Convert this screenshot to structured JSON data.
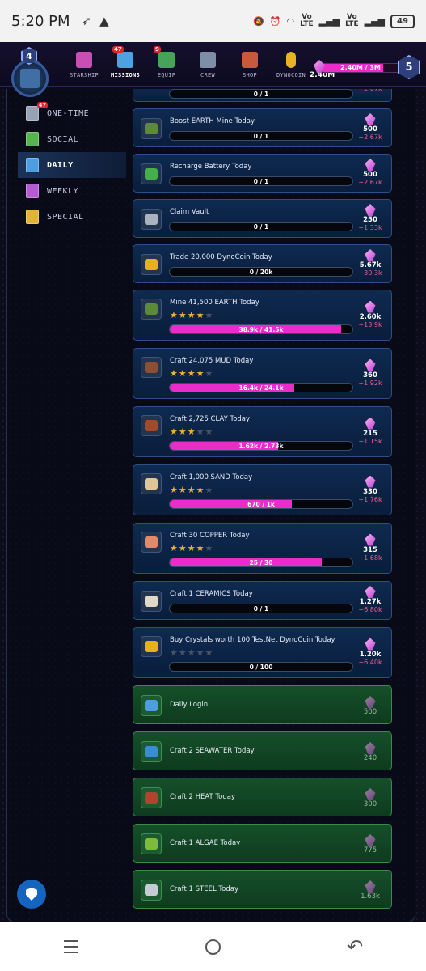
{
  "status_bar": {
    "time": "5:20 PM",
    "battery": "49",
    "vo_lte": "Vo\nLTE"
  },
  "header": {
    "player_level": "4",
    "rank": "5",
    "dynocoin_value": "2.40M",
    "crystals": {
      "label": "2.40M / 3M",
      "fill": 0.8
    },
    "nav": [
      {
        "label": "STARSHIP",
        "color": "#c94fb5"
      },
      {
        "label": "MISSIONS",
        "badge": "47",
        "color": "#4da3e0"
      },
      {
        "label": "EQUIP",
        "badge": "9",
        "color": "#46a35a"
      },
      {
        "label": "CREW",
        "color": "#7e8ea6"
      },
      {
        "label": "SHOP",
        "color": "#c8593c"
      },
      {
        "label": "DYNOCOIN",
        "color": "#e8b220"
      }
    ]
  },
  "sidebar": {
    "items": [
      {
        "label": "ONE-TIME",
        "badge": "47",
        "color": "#98a2b5"
      },
      {
        "label": "SOCIAL",
        "color": "#55b450"
      },
      {
        "label": "DAILY",
        "color": "#4d9de0"
      },
      {
        "label": "WEEKLY",
        "color": "#b65bd1"
      },
      {
        "label": "SPECIAL",
        "color": "#e3b338"
      }
    ]
  },
  "missions": [
    {
      "title": "",
      "progress": "0 / 1",
      "fill": 0,
      "reward": "",
      "xp": "+2.67k",
      "color": "#5a6a85",
      "partial": true
    },
    {
      "title": "Boost EARTH Mine Today",
      "progress": "0 / 1",
      "fill": 0,
      "reward": "500",
      "xp": "+2.67k",
      "color": "#5d8a3a"
    },
    {
      "title": "Recharge Battery Today",
      "progress": "0 / 1",
      "fill": 0,
      "reward": "500",
      "xp": "+2.67k",
      "color": "#43b04a"
    },
    {
      "title": "Claim Vault",
      "progress": "0 / 1",
      "fill": 0,
      "reward": "250",
      "xp": "+1.33k",
      "color": "#a9b2be"
    },
    {
      "title": "Trade 20,000 DynoCoin Today",
      "progress": "0 / 20k",
      "fill": 0,
      "reward": "5.67k",
      "xp": "+30.3k",
      "color": "#e5b21e"
    },
    {
      "title": "Mine 41,500 EARTH Today",
      "stars": 4,
      "progress": "38.9k / 41.5k",
      "fill": 0.937,
      "reward": "2.60k",
      "xp": "+13.9k",
      "color": "#5d8a3a"
    },
    {
      "title": "Craft 24,075 MUD Today",
      "stars": 4,
      "progress": "16.4k / 24.1k",
      "fill": 0.68,
      "reward": "360",
      "xp": "+1.92k",
      "color": "#8a4f34"
    },
    {
      "title": "Craft 2,725 CLAY Today",
      "stars": 3,
      "progress": "1.62k / 2.73k",
      "fill": 0.594,
      "reward": "215",
      "xp": "+1.15k",
      "color": "#a04a2e"
    },
    {
      "title": "Craft 1,000 SAND Today",
      "stars": 4,
      "progress": "670 / 1k",
      "fill": 0.67,
      "reward": "330",
      "xp": "+1.76k",
      "color": "#e0c49a"
    },
    {
      "title": "Craft 30 COPPER Today",
      "stars": 4,
      "progress": "25 / 30",
      "fill": 0.833,
      "reward": "315",
      "xp": "+1.68k",
      "color": "#e08a6a"
    },
    {
      "title": "Craft 1 CERAMICS Today",
      "progress": "0 / 1",
      "fill": 0,
      "reward": "1.27k",
      "xp": "+6.80k",
      "color": "#e0d8c8"
    },
    {
      "title": "Buy Crystals worth 100 TestNet DynoCoin Today",
      "stars": 0,
      "progress": "0 / 100",
      "fill": 0,
      "reward": "1.20k",
      "xp": "+6.40k",
      "color": "#e5b21e"
    },
    {
      "title": "Daily Login",
      "done": true,
      "reward": "500",
      "color": "#4d9de0"
    },
    {
      "title": "Craft 2 SEAWATER Today",
      "done": true,
      "reward": "240",
      "color": "#3a8ed0"
    },
    {
      "title": "Craft 2 HEAT Today",
      "done": true,
      "reward": "300",
      "color": "#b0442e"
    },
    {
      "title": "Craft 1 ALGAE Today",
      "done": true,
      "reward": "775",
      "color": "#7dbb3a"
    },
    {
      "title": "Craft 1 STEEL Today",
      "done": true,
      "reward": "1.63k",
      "color": "#c6ccd6"
    }
  ]
}
